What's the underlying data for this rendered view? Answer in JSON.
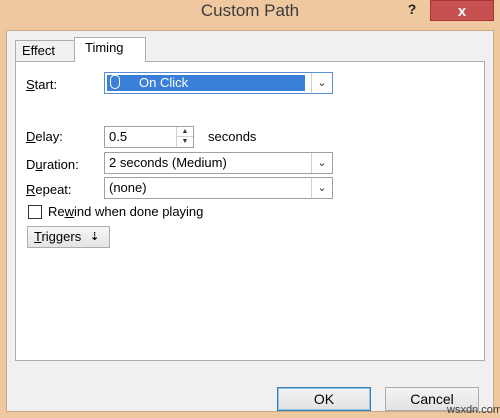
{
  "window": {
    "title": "Custom Path",
    "help": "?",
    "close": "x"
  },
  "tabs": [
    {
      "label": "Effect"
    },
    {
      "label": "Timing"
    }
  ],
  "timing": {
    "start_label_u": "S",
    "start_label_rest": "tart:",
    "start_value": "On Click",
    "delay_label_u": "D",
    "delay_label_rest": "elay:",
    "delay_value": "0.5",
    "delay_units": "seconds",
    "duration_label_pre": "D",
    "duration_label_u": "u",
    "duration_label_rest": "ration:",
    "duration_value": "2 seconds (Medium)",
    "repeat_label_u": "R",
    "repeat_label_rest": "epeat:",
    "repeat_value": "(none)",
    "rewind_pre": "Re",
    "rewind_u": "w",
    "rewind_rest": "ind when done playing",
    "rewind_checked": false,
    "triggers_u": "T",
    "triggers_rest": "riggers",
    "triggers_chevron": "⯯"
  },
  "buttons": {
    "ok": "OK",
    "cancel": "Cancel"
  },
  "watermark": "wsxdn.com",
  "colors": {
    "title_bar": "#f0c8a0",
    "close": "#c75050",
    "selection": "#3a7fd8"
  },
  "icons": {
    "start_icon": "mouse-icon",
    "dropdown": "chevron-down-icon",
    "spin": "spin-arrows-icon"
  }
}
